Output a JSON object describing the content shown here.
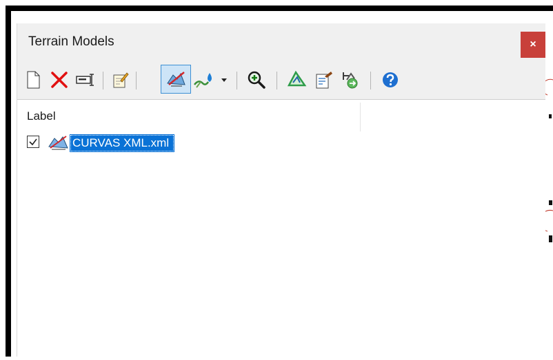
{
  "window": {
    "title": "Terrain Models",
    "close_glyph": "×"
  },
  "toolbar": {
    "buttons": [
      {
        "name": "new-icon"
      },
      {
        "name": "delete-icon"
      },
      {
        "name": "rename-icon"
      },
      {
        "name": "properties-icon"
      },
      {
        "name": "terrain-display-icon",
        "active": true
      },
      {
        "name": "drainage-icon"
      },
      {
        "name": "dropdown-arrow-icon"
      },
      {
        "name": "zoom-in-icon"
      },
      {
        "name": "boundary-icon"
      },
      {
        "name": "report-icon"
      },
      {
        "name": "import-icon"
      },
      {
        "name": "help-icon"
      }
    ]
  },
  "list": {
    "column_header": "Label",
    "items": [
      {
        "label": "CURVAS XML.xml",
        "checked": true,
        "selected": true,
        "icon": "terrain-model-icon"
      }
    ]
  },
  "colors": {
    "close_button": "#c8403a",
    "selection": "#0a72d6",
    "active_button": "#cde4f7"
  }
}
